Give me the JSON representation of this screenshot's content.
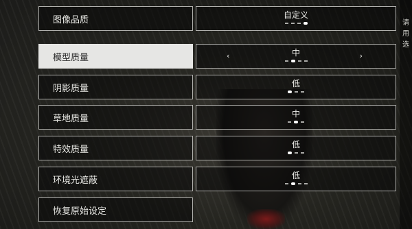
{
  "settings": [
    {
      "label": "图像品质",
      "value": "自定义",
      "level": 4,
      "levels": 4
    },
    {
      "label": "模型质量",
      "value": "中",
      "level": 2,
      "levels": 4
    },
    {
      "label": "阴影质量",
      "value": "低",
      "level": 1,
      "levels": 3
    },
    {
      "label": "草地质量",
      "value": "中",
      "level": 2,
      "levels": 3
    },
    {
      "label": "特效质量",
      "value": "低",
      "level": 1,
      "levels": 3
    },
    {
      "label": "环境光遮蔽",
      "value": "低",
      "level": 2,
      "levels": 4
    }
  ],
  "reset_label": "恢复原始设定",
  "arrows": {
    "left": "‹",
    "right": "›"
  },
  "side_text": "请用选"
}
